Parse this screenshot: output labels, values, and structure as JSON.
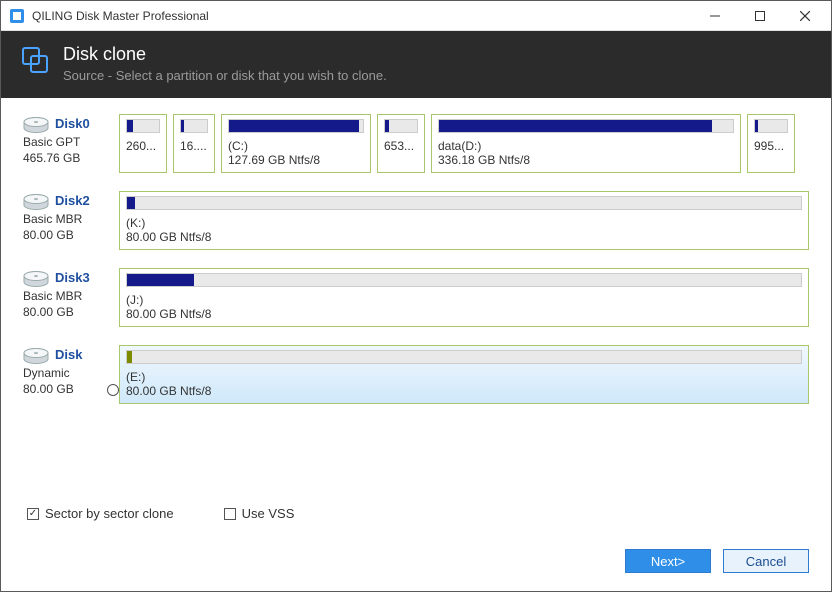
{
  "app": {
    "title": "QILING Disk Master Professional"
  },
  "header": {
    "title": "Disk clone",
    "subtitle": "Source - Select a partition or disk that you wish to clone."
  },
  "disks": [
    {
      "name": "Disk0",
      "type": "Basic GPT",
      "size": "465.76 GB",
      "selected": false,
      "partitions": [
        {
          "label": "",
          "info": "260...",
          "fillPct": 18,
          "widthPx": 48
        },
        {
          "label": "",
          "info": "16....",
          "fillPct": 10,
          "widthPx": 42
        },
        {
          "label": "(C:)",
          "info": "127.69 GB Ntfs/8",
          "fillPct": 97,
          "widthPx": 150
        },
        {
          "label": "",
          "info": "653...",
          "fillPct": 12,
          "widthPx": 48
        },
        {
          "label": "data(D:)",
          "info": "336.18 GB Ntfs/8",
          "fillPct": 93,
          "widthPx": 310
        },
        {
          "label": "",
          "info": "995...",
          "fillPct": 8,
          "widthPx": 48
        }
      ]
    },
    {
      "name": "Disk2",
      "type": "Basic MBR",
      "size": "80.00 GB",
      "selected": false,
      "partitions": [
        {
          "label": "(K:)",
          "info": "80.00 GB Ntfs/8",
          "fillPct": 1.2,
          "flex": 1
        }
      ]
    },
    {
      "name": "Disk3",
      "type": "Basic MBR",
      "size": "80.00 GB",
      "selected": false,
      "partitions": [
        {
          "label": "(J:)",
          "info": "80.00 GB Ntfs/8",
          "fillPct": 10,
          "flex": 1
        }
      ]
    },
    {
      "name": "Disk",
      "type": "Dynamic",
      "size": "80.00 GB",
      "selected": true,
      "showRadio": true,
      "partitions": [
        {
          "label": "(E:)",
          "info": "80.00 GB Ntfs/8",
          "fillPct": 0.8,
          "flex": 1,
          "selected": true,
          "fillColor": "#7d8b00"
        }
      ]
    }
  ],
  "options": {
    "sector_label": "Sector by sector clone",
    "sector_checked": true,
    "vss_label": "Use VSS",
    "vss_checked": false
  },
  "footer": {
    "next": "Next>",
    "cancel": "Cancel"
  }
}
